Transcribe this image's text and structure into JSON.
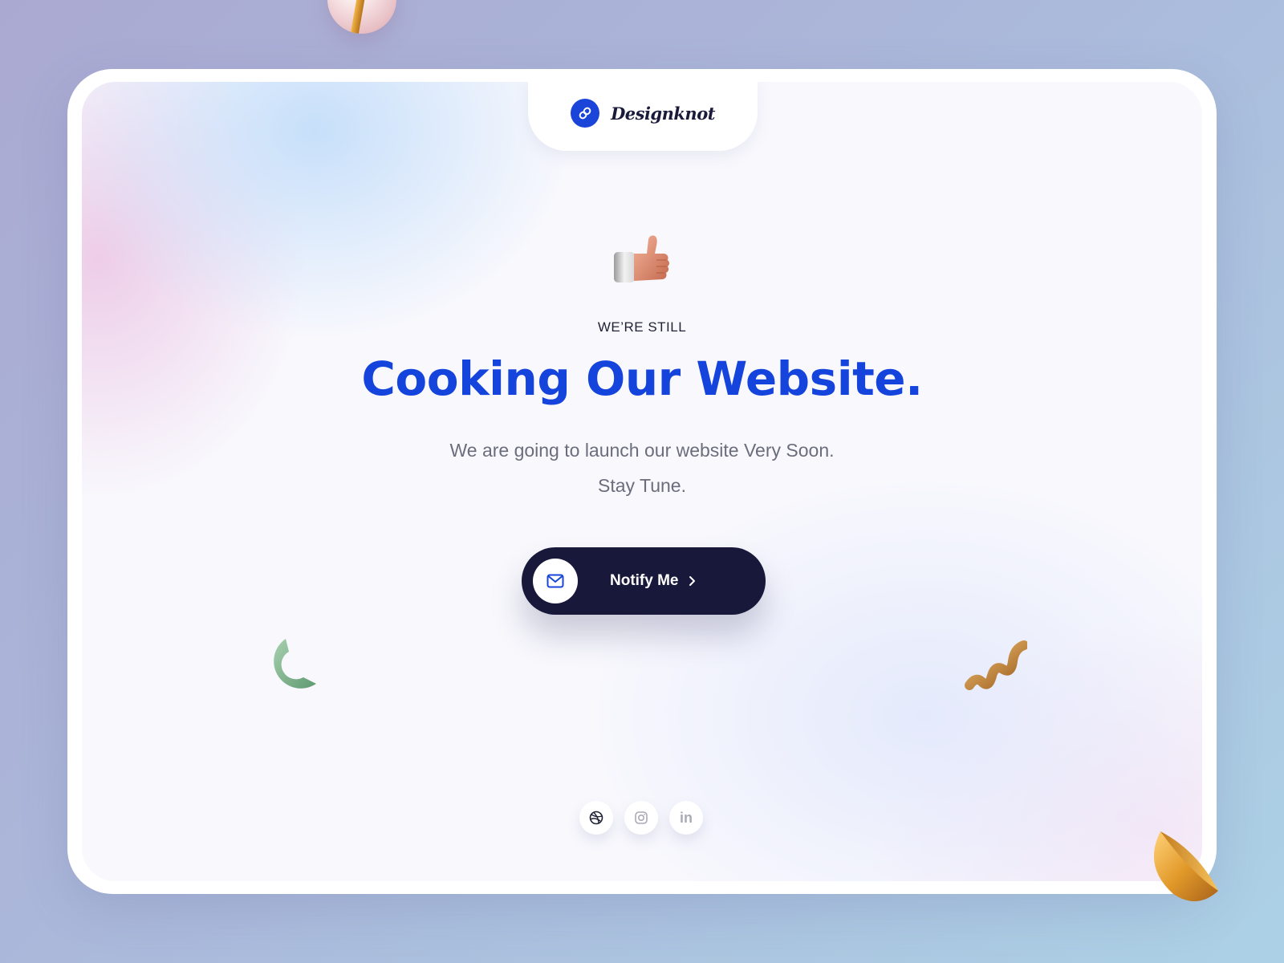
{
  "brand": {
    "name": "Designknot",
    "accent_color": "#1b45d9",
    "logo_icon": "link-icon"
  },
  "hero": {
    "emoji": "thumbs-up-icon",
    "eyebrow": "WE’RE STILL",
    "headline": "Cooking Our Website.",
    "subline_1": "We are going to launch our website Very Soon.",
    "subline_2": "Stay Tune.",
    "headline_color": "#1544dd"
  },
  "notify_button": {
    "label": "Notify Me",
    "icon": "mail-icon",
    "chevron": "chevron-right-icon",
    "bg_color": "#17183a"
  },
  "social": [
    {
      "name": "dribbble",
      "icon": "dribbble-icon"
    },
    {
      "name": "instagram",
      "icon": "instagram-icon"
    },
    {
      "name": "linkedin",
      "icon": "linkedin-icon",
      "text": "in"
    }
  ]
}
